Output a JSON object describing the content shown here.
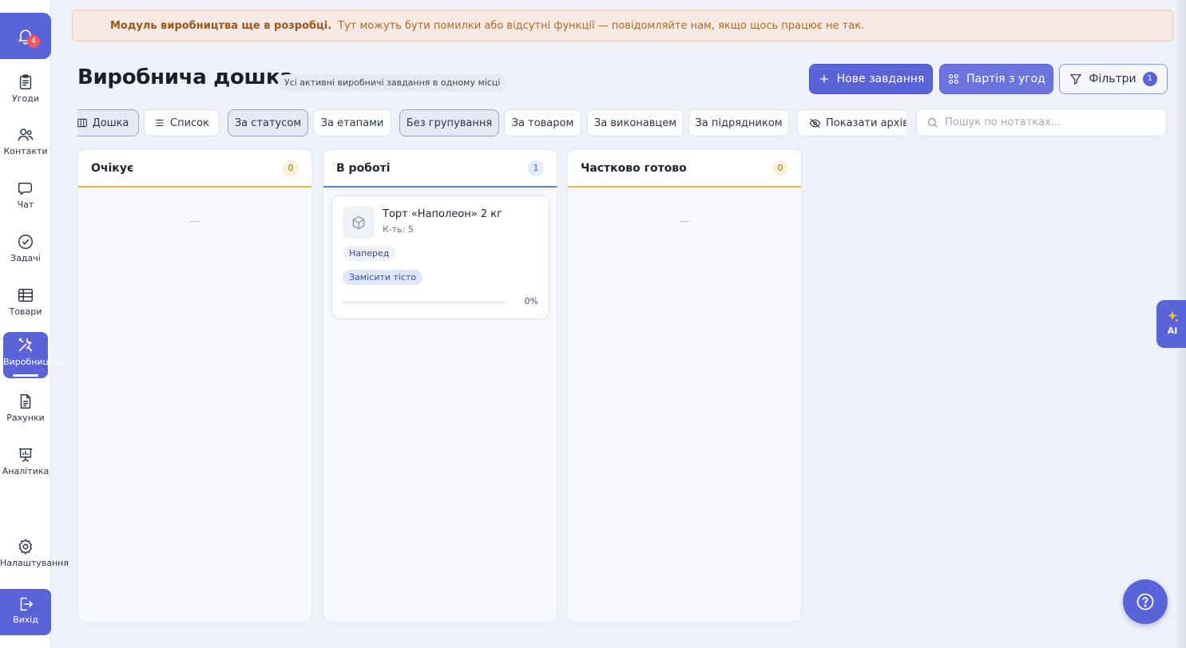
{
  "notifications": {
    "count": "4"
  },
  "sidebar": {
    "items": [
      {
        "label": "Угоди",
        "icon": "clipboard-icon"
      },
      {
        "label": "Контакти",
        "icon": "users-icon"
      },
      {
        "label": "Чат",
        "icon": "chat-icon"
      },
      {
        "label": "Задачі",
        "icon": "check-circle-icon"
      },
      {
        "label": "Товари",
        "icon": "table-icon"
      },
      {
        "label": "Виробництво",
        "icon": "tools-icon",
        "active": true
      },
      {
        "label": "Рахунки",
        "icon": "document-icon"
      },
      {
        "label": "Аналітика",
        "icon": "presentation-chart-icon"
      }
    ],
    "settings": {
      "label": "Налаштування",
      "icon": "gear-icon"
    },
    "logout": {
      "label": "Вихід",
      "icon": "logout-icon"
    }
  },
  "banner": {
    "title": "Модуль виробництва ще в розробці.",
    "text": "Тут можуть бути помилки або відсутні функції — повідомляйте нам, якщо щось працює не так."
  },
  "header": {
    "title": "Виробнича дошка",
    "subtitle": "Усі активні виробничі завдання в одному місці",
    "new_task_label": "Нове завдання",
    "batch_label": "Партія з угод",
    "filters_label": "Фільтри",
    "filters_count": "1"
  },
  "toolbar": {
    "view_board": "Дошка",
    "view_list": "Список",
    "by_status": "За статусом",
    "by_stages": "За етапами",
    "no_grouping": "Без групування",
    "by_product": "За товаром",
    "by_assignee": "За виконавцем",
    "by_contractor": "За підрядником",
    "show_archive": "Показати архів"
  },
  "search": {
    "placeholder": "Пошук по нотатках..."
  },
  "columns": [
    {
      "title": "Очікує",
      "count": "0",
      "accent": "#e8b63c",
      "empty": "—"
    },
    {
      "title": "В роботі",
      "count": "1",
      "accent": "#5b7fd6"
    },
    {
      "title": "Частково готово",
      "count": "0",
      "accent": "#e8b63c",
      "empty": "—"
    }
  ],
  "card": {
    "title": "Торт «Наполеон» 2 кг",
    "qty": "К-ть: 5",
    "priority": "Наперед",
    "stage": "Замісити тісто",
    "progress_label": "0%",
    "progress": 0
  },
  "ai_button": {
    "label": "AI"
  },
  "colors": {
    "accent": "#5b63d8",
    "banner_bg": "#f7e9e3",
    "warning_text": "#b06a1f"
  }
}
